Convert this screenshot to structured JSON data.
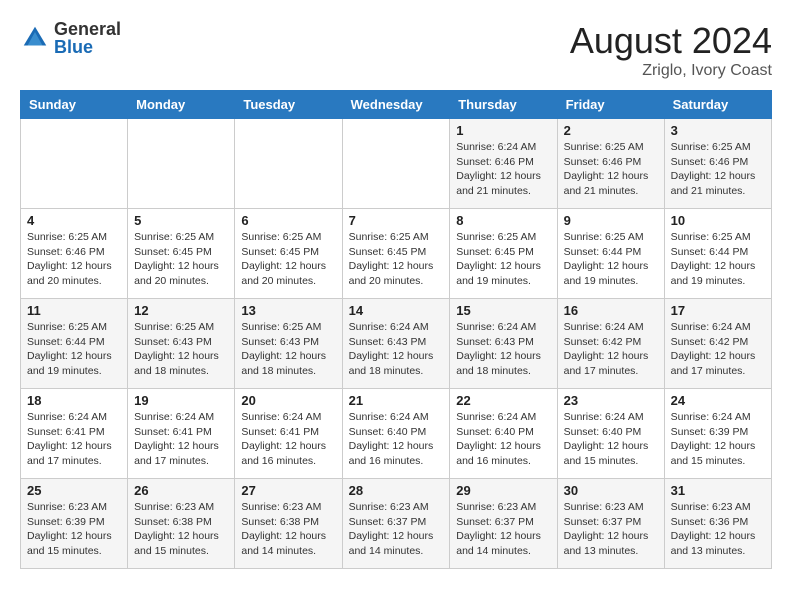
{
  "header": {
    "logo_general": "General",
    "logo_blue": "Blue",
    "month_year": "August 2024",
    "location": "Zriglo, Ivory Coast"
  },
  "days_of_week": [
    "Sunday",
    "Monday",
    "Tuesday",
    "Wednesday",
    "Thursday",
    "Friday",
    "Saturday"
  ],
  "weeks": [
    [
      {
        "day": "",
        "sunrise": "",
        "sunset": "",
        "daylight": ""
      },
      {
        "day": "",
        "sunrise": "",
        "sunset": "",
        "daylight": ""
      },
      {
        "day": "",
        "sunrise": "",
        "sunset": "",
        "daylight": ""
      },
      {
        "day": "",
        "sunrise": "",
        "sunset": "",
        "daylight": ""
      },
      {
        "day": "1",
        "sunrise": "Sunrise: 6:24 AM",
        "sunset": "Sunset: 6:46 PM",
        "daylight": "Daylight: 12 hours and 21 minutes."
      },
      {
        "day": "2",
        "sunrise": "Sunrise: 6:25 AM",
        "sunset": "Sunset: 6:46 PM",
        "daylight": "Daylight: 12 hours and 21 minutes."
      },
      {
        "day": "3",
        "sunrise": "Sunrise: 6:25 AM",
        "sunset": "Sunset: 6:46 PM",
        "daylight": "Daylight: 12 hours and 21 minutes."
      }
    ],
    [
      {
        "day": "4",
        "sunrise": "Sunrise: 6:25 AM",
        "sunset": "Sunset: 6:46 PM",
        "daylight": "Daylight: 12 hours and 20 minutes."
      },
      {
        "day": "5",
        "sunrise": "Sunrise: 6:25 AM",
        "sunset": "Sunset: 6:45 PM",
        "daylight": "Daylight: 12 hours and 20 minutes."
      },
      {
        "day": "6",
        "sunrise": "Sunrise: 6:25 AM",
        "sunset": "Sunset: 6:45 PM",
        "daylight": "Daylight: 12 hours and 20 minutes."
      },
      {
        "day": "7",
        "sunrise": "Sunrise: 6:25 AM",
        "sunset": "Sunset: 6:45 PM",
        "daylight": "Daylight: 12 hours and 20 minutes."
      },
      {
        "day": "8",
        "sunrise": "Sunrise: 6:25 AM",
        "sunset": "Sunset: 6:45 PM",
        "daylight": "Daylight: 12 hours and 19 minutes."
      },
      {
        "day": "9",
        "sunrise": "Sunrise: 6:25 AM",
        "sunset": "Sunset: 6:44 PM",
        "daylight": "Daylight: 12 hours and 19 minutes."
      },
      {
        "day": "10",
        "sunrise": "Sunrise: 6:25 AM",
        "sunset": "Sunset: 6:44 PM",
        "daylight": "Daylight: 12 hours and 19 minutes."
      }
    ],
    [
      {
        "day": "11",
        "sunrise": "Sunrise: 6:25 AM",
        "sunset": "Sunset: 6:44 PM",
        "daylight": "Daylight: 12 hours and 19 minutes."
      },
      {
        "day": "12",
        "sunrise": "Sunrise: 6:25 AM",
        "sunset": "Sunset: 6:43 PM",
        "daylight": "Daylight: 12 hours and 18 minutes."
      },
      {
        "day": "13",
        "sunrise": "Sunrise: 6:25 AM",
        "sunset": "Sunset: 6:43 PM",
        "daylight": "Daylight: 12 hours and 18 minutes."
      },
      {
        "day": "14",
        "sunrise": "Sunrise: 6:24 AM",
        "sunset": "Sunset: 6:43 PM",
        "daylight": "Daylight: 12 hours and 18 minutes."
      },
      {
        "day": "15",
        "sunrise": "Sunrise: 6:24 AM",
        "sunset": "Sunset: 6:43 PM",
        "daylight": "Daylight: 12 hours and 18 minutes."
      },
      {
        "day": "16",
        "sunrise": "Sunrise: 6:24 AM",
        "sunset": "Sunset: 6:42 PM",
        "daylight": "Daylight: 12 hours and 17 minutes."
      },
      {
        "day": "17",
        "sunrise": "Sunrise: 6:24 AM",
        "sunset": "Sunset: 6:42 PM",
        "daylight": "Daylight: 12 hours and 17 minutes."
      }
    ],
    [
      {
        "day": "18",
        "sunrise": "Sunrise: 6:24 AM",
        "sunset": "Sunset: 6:41 PM",
        "daylight": "Daylight: 12 hours and 17 minutes."
      },
      {
        "day": "19",
        "sunrise": "Sunrise: 6:24 AM",
        "sunset": "Sunset: 6:41 PM",
        "daylight": "Daylight: 12 hours and 17 minutes."
      },
      {
        "day": "20",
        "sunrise": "Sunrise: 6:24 AM",
        "sunset": "Sunset: 6:41 PM",
        "daylight": "Daylight: 12 hours and 16 minutes."
      },
      {
        "day": "21",
        "sunrise": "Sunrise: 6:24 AM",
        "sunset": "Sunset: 6:40 PM",
        "daylight": "Daylight: 12 hours and 16 minutes."
      },
      {
        "day": "22",
        "sunrise": "Sunrise: 6:24 AM",
        "sunset": "Sunset: 6:40 PM",
        "daylight": "Daylight: 12 hours and 16 minutes."
      },
      {
        "day": "23",
        "sunrise": "Sunrise: 6:24 AM",
        "sunset": "Sunset: 6:40 PM",
        "daylight": "Daylight: 12 hours and 15 minutes."
      },
      {
        "day": "24",
        "sunrise": "Sunrise: 6:24 AM",
        "sunset": "Sunset: 6:39 PM",
        "daylight": "Daylight: 12 hours and 15 minutes."
      }
    ],
    [
      {
        "day": "25",
        "sunrise": "Sunrise: 6:23 AM",
        "sunset": "Sunset: 6:39 PM",
        "daylight": "Daylight: 12 hours and 15 minutes."
      },
      {
        "day": "26",
        "sunrise": "Sunrise: 6:23 AM",
        "sunset": "Sunset: 6:38 PM",
        "daylight": "Daylight: 12 hours and 15 minutes."
      },
      {
        "day": "27",
        "sunrise": "Sunrise: 6:23 AM",
        "sunset": "Sunset: 6:38 PM",
        "daylight": "Daylight: 12 hours and 14 minutes."
      },
      {
        "day": "28",
        "sunrise": "Sunrise: 6:23 AM",
        "sunset": "Sunset: 6:37 PM",
        "daylight": "Daylight: 12 hours and 14 minutes."
      },
      {
        "day": "29",
        "sunrise": "Sunrise: 6:23 AM",
        "sunset": "Sunset: 6:37 PM",
        "daylight": "Daylight: 12 hours and 14 minutes."
      },
      {
        "day": "30",
        "sunrise": "Sunrise: 6:23 AM",
        "sunset": "Sunset: 6:37 PM",
        "daylight": "Daylight: 12 hours and 13 minutes."
      },
      {
        "day": "31",
        "sunrise": "Sunrise: 6:23 AM",
        "sunset": "Sunset: 6:36 PM",
        "daylight": "Daylight: 12 hours and 13 minutes."
      }
    ]
  ]
}
